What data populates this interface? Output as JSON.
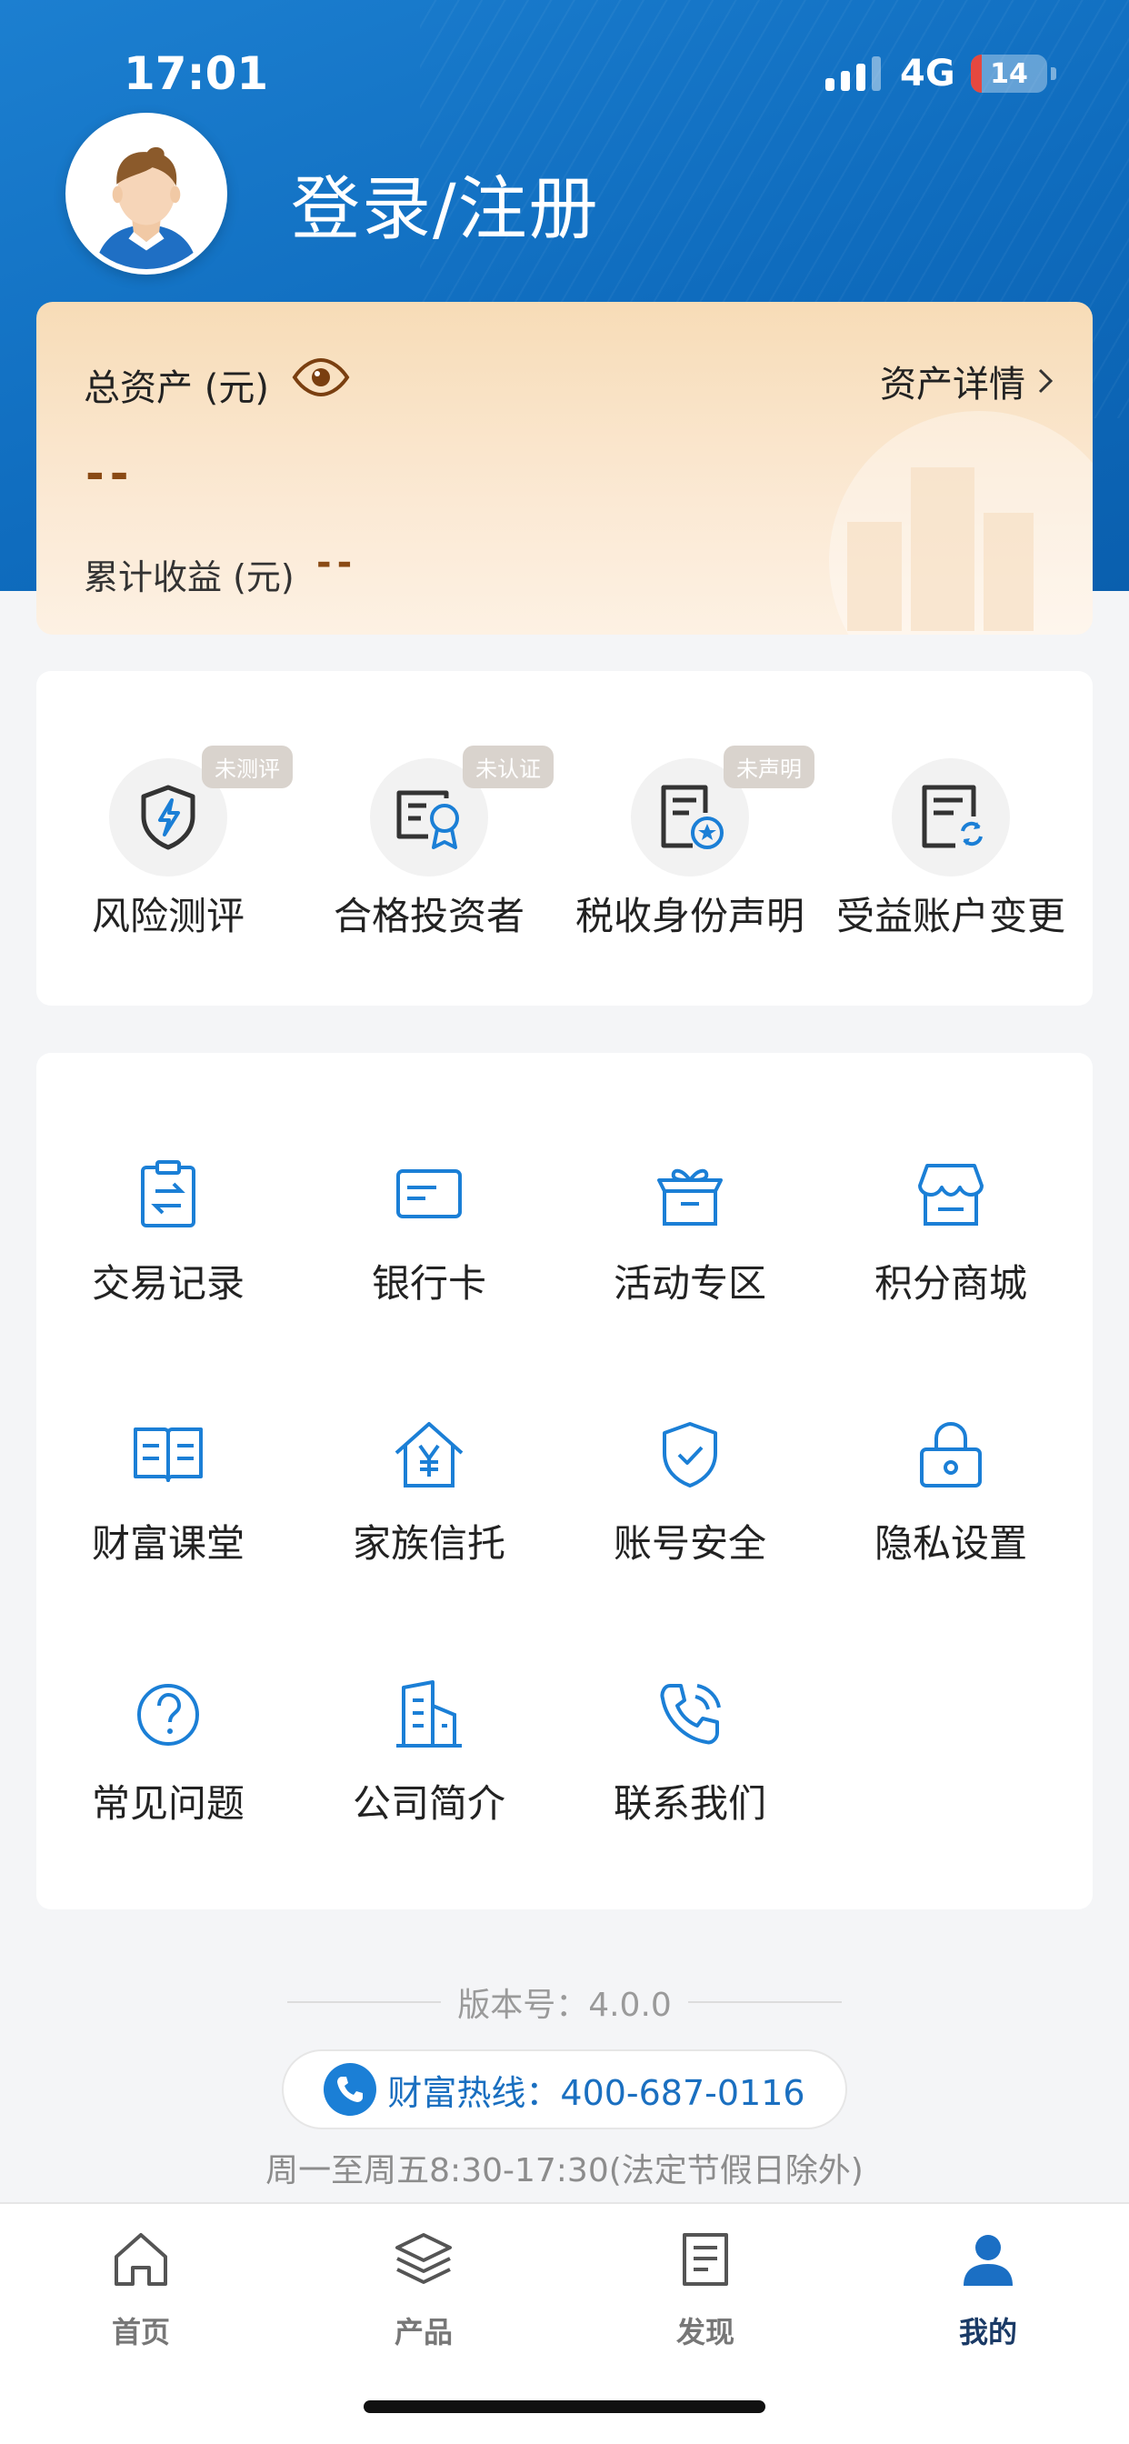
{
  "status_bar": {
    "time": "17:01",
    "network": "4G",
    "battery": "14"
  },
  "header": {
    "login_text": "登录/注册"
  },
  "asset_card": {
    "total_label": "总资产 (元)",
    "detail_link": "资产详情",
    "total_value": "--",
    "income_label": "累计收益 (元)",
    "income_value": "--"
  },
  "quick_items": [
    {
      "label": "风险测评",
      "badge": "未测评",
      "icon": "shield-lightning-icon"
    },
    {
      "label": "合格投资者",
      "badge": "未认证",
      "icon": "certificate-icon"
    },
    {
      "label": "税收身份声明",
      "badge": "未声明",
      "icon": "document-star-icon"
    },
    {
      "label": "受益账户变更",
      "badge": "",
      "icon": "document-refresh-icon"
    }
  ],
  "menu_items": [
    {
      "label": "交易记录",
      "icon": "clipboard-transfer-icon"
    },
    {
      "label": "银行卡",
      "icon": "bank-card-icon"
    },
    {
      "label": "活动专区",
      "icon": "gift-box-icon"
    },
    {
      "label": "积分商城",
      "icon": "store-icon"
    },
    {
      "label": "财富课堂",
      "icon": "open-book-icon"
    },
    {
      "label": "家族信托",
      "icon": "house-yen-icon"
    },
    {
      "label": "账号安全",
      "icon": "shield-check-icon"
    },
    {
      "label": "隐私设置",
      "icon": "lock-icon"
    },
    {
      "label": "常见问题",
      "icon": "question-icon"
    },
    {
      "label": "公司简介",
      "icon": "building-icon"
    },
    {
      "label": "联系我们",
      "icon": "phone-icon"
    }
  ],
  "footer": {
    "version": "版本号：4.0.0",
    "hotline": "财富热线：400-687-0116",
    "hours": "周一至周五8:30-17:30(法定节假日除外)"
  },
  "tabs": [
    {
      "label": "首页",
      "icon": "home-icon"
    },
    {
      "label": "产品",
      "icon": "layers-icon"
    },
    {
      "label": "发现",
      "icon": "document-list-icon"
    },
    {
      "label": "我的",
      "icon": "user-icon",
      "active": true
    }
  ],
  "colors": {
    "primary": "#1b7fd6",
    "header_bg": "#0f6cbe",
    "asset_text": "#8a4a14",
    "tab_active": "#1a3a66"
  }
}
